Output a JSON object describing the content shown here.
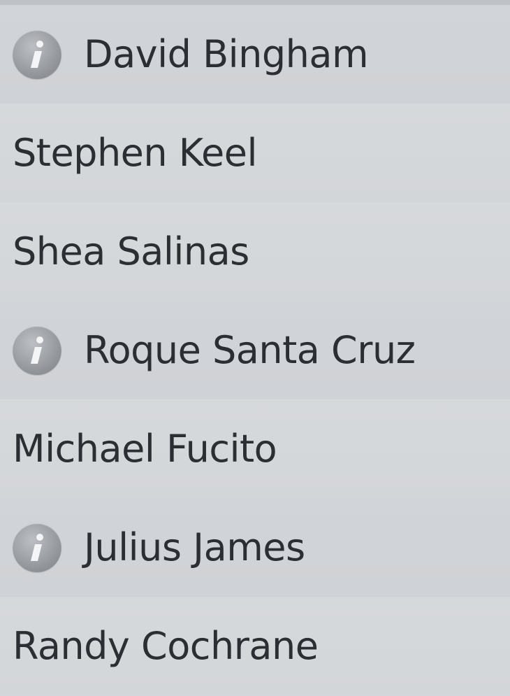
{
  "players": [
    {
      "name": "David Bingham",
      "has_info": true,
      "info_icon": "info-icon"
    },
    {
      "name": "Stephen Keel",
      "has_info": false
    },
    {
      "name": "Shea Salinas",
      "has_info": false
    },
    {
      "name": "Roque Santa Cruz",
      "has_info": true,
      "info_icon": "info-icon"
    },
    {
      "name": "Michael Fucito",
      "has_info": false
    },
    {
      "name": "Julius James",
      "has_info": true,
      "info_icon": "info-icon"
    },
    {
      "name": "Randy Cochrane",
      "has_info": false
    }
  ],
  "colors": {
    "row_a": "#d1d4d8",
    "row_b": "#d6d9dc",
    "text": "#2b2e32",
    "info_badge": "#8f9397"
  }
}
